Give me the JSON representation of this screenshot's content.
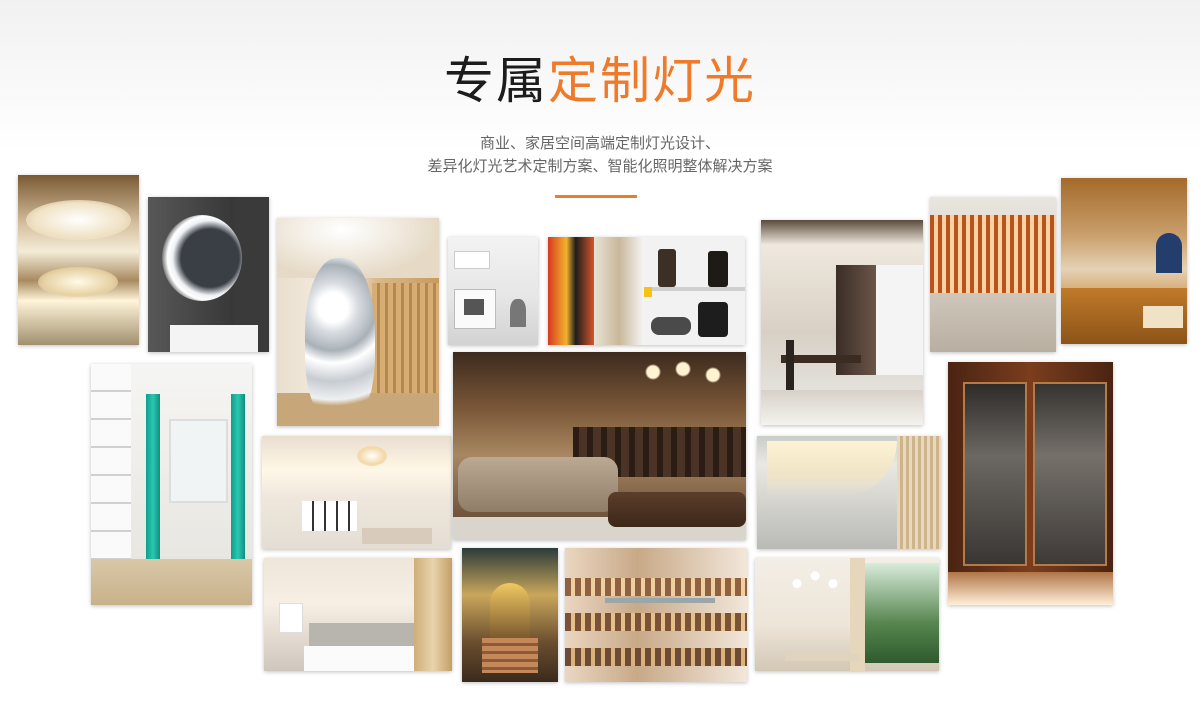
{
  "header": {
    "title_plain": "专属",
    "title_accent": "定制灯光",
    "subtitle_line1": "商业、家居空间高端定制灯光设计、",
    "subtitle_line2": "差异化灯光艺术定制方案、智能化照明整体解决方案"
  },
  "colors": {
    "accent": "#ef7a2a",
    "title": "#1c1c1c",
    "subtitle": "#666666"
  },
  "gallery": {
    "photos": [
      "ceiling-chandelier",
      "round-backlit-mirror",
      "crystal-light-art",
      "kitchen-undercabinet",
      "clothes-and-shoe-cabinet",
      "dining-room-wine-wall",
      "slat-wave-wall",
      "arched-wood-room",
      "teal-curtain-wardrobe",
      "living-room-ceiling",
      "lounge-bar",
      "lit-wall-cove",
      "glass-walk-in-closet",
      "hotel-bedroom",
      "ornate-hall",
      "library-atrium",
      "sunroom-dining"
    ]
  }
}
